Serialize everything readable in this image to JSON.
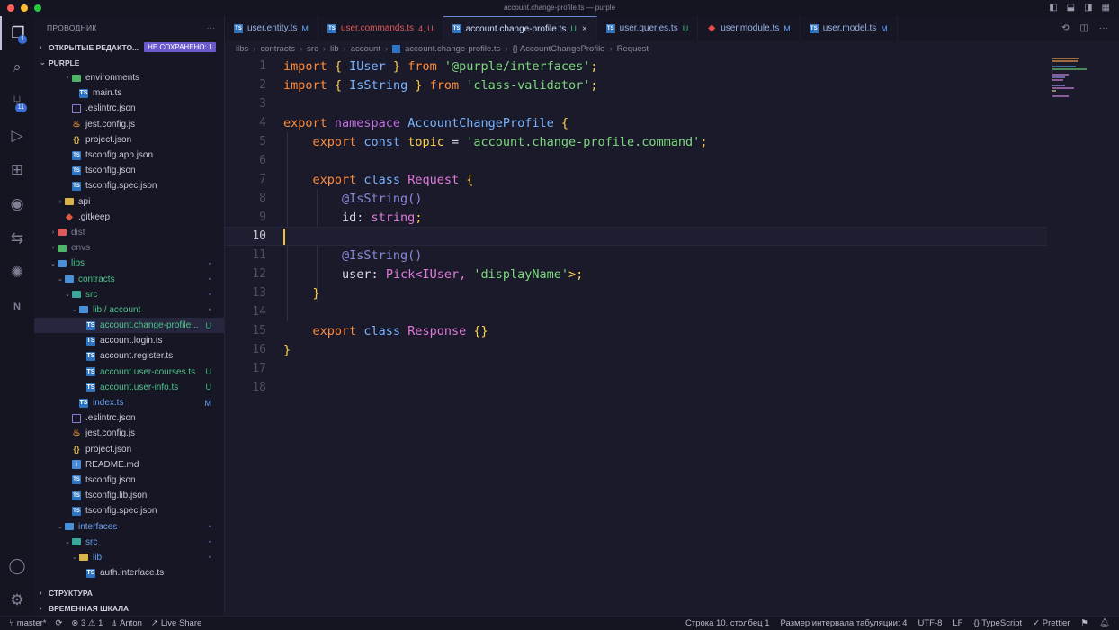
{
  "window": {
    "title": "account.change-profile.ts — purple"
  },
  "activity": {
    "explorer_badge": "1",
    "git_badge": "11"
  },
  "sidebar": {
    "header": "ПРОВОДНИК",
    "open_editors": "ОТКРЫТЫЕ РЕДАКТО...",
    "unsaved_badge": "НЕ СОХРАНЕНО: 1",
    "root": "PURPLE",
    "rows": [
      {
        "label": "environments",
        "indent": 3,
        "chev": "›",
        "icon": "folder green",
        "color": "",
        "stat": ""
      },
      {
        "label": "main.ts",
        "indent": 4,
        "chev": "",
        "icon": "ts",
        "color": "",
        "stat": ""
      },
      {
        "label": ".eslintrc.json",
        "indent": 3,
        "chev": "",
        "icon": "es",
        "color": "",
        "stat": ""
      },
      {
        "label": "jest.config.js",
        "indent": 3,
        "chev": "",
        "icon": "js",
        "color": "",
        "stat": ""
      },
      {
        "label": "project.json",
        "indent": 3,
        "chev": "",
        "icon": "json",
        "color": "",
        "stat": ""
      },
      {
        "label": "tsconfig.app.json",
        "indent": 3,
        "chev": "",
        "icon": "tsconf",
        "color": "",
        "stat": ""
      },
      {
        "label": "tsconfig.json",
        "indent": 3,
        "chev": "",
        "icon": "tsconf",
        "color": "",
        "stat": ""
      },
      {
        "label": "tsconfig.spec.json",
        "indent": 3,
        "chev": "",
        "icon": "tsconf",
        "color": "",
        "stat": ""
      },
      {
        "label": "api",
        "indent": 2,
        "chev": "›",
        "icon": "folder yellow",
        "color": "",
        "stat": ""
      },
      {
        "label": ".gitkeep",
        "indent": 2,
        "chev": "",
        "icon": "git",
        "color": "",
        "stat": ""
      },
      {
        "label": "dist",
        "indent": 1,
        "chev": "›",
        "icon": "folder red",
        "color": "gray",
        "stat": ""
      },
      {
        "label": "envs",
        "indent": 1,
        "chev": "›",
        "icon": "folder green",
        "color": "gray",
        "stat": ""
      },
      {
        "label": "libs",
        "indent": 1,
        "chev": "⌄",
        "icon": "folder",
        "color": "green",
        "stat": "•"
      },
      {
        "label": "contracts",
        "indent": 2,
        "chev": "⌄",
        "icon": "folder",
        "color": "green",
        "stat": "•"
      },
      {
        "label": "src",
        "indent": 3,
        "chev": "⌄",
        "icon": "folder teal",
        "color": "green",
        "stat": "•"
      },
      {
        "label": "lib / account",
        "indent": 4,
        "chev": "⌄",
        "icon": "folder",
        "color": "green",
        "stat": "•"
      },
      {
        "label": "account.change-profile...",
        "indent": 5,
        "chev": "",
        "icon": "ts",
        "color": "green",
        "stat": "U",
        "selected": true
      },
      {
        "label": "account.login.ts",
        "indent": 5,
        "chev": "",
        "icon": "ts",
        "color": "",
        "stat": ""
      },
      {
        "label": "account.register.ts",
        "indent": 5,
        "chev": "",
        "icon": "ts",
        "color": "",
        "stat": ""
      },
      {
        "label": "account.user-courses.ts",
        "indent": 5,
        "chev": "",
        "icon": "ts",
        "color": "green",
        "stat": "U"
      },
      {
        "label": "account.user-info.ts",
        "indent": 5,
        "chev": "",
        "icon": "ts",
        "color": "green",
        "stat": "U"
      },
      {
        "label": "index.ts",
        "indent": 4,
        "chev": "",
        "icon": "ts",
        "color": "blue",
        "stat": "M"
      },
      {
        "label": ".eslintrc.json",
        "indent": 3,
        "chev": "",
        "icon": "es",
        "color": "",
        "stat": ""
      },
      {
        "label": "jest.config.js",
        "indent": 3,
        "chev": "",
        "icon": "js",
        "color": "",
        "stat": ""
      },
      {
        "label": "project.json",
        "indent": 3,
        "chev": "",
        "icon": "json",
        "color": "",
        "stat": ""
      },
      {
        "label": "README.md",
        "indent": 3,
        "chev": "",
        "icon": "info",
        "color": "",
        "stat": ""
      },
      {
        "label": "tsconfig.json",
        "indent": 3,
        "chev": "",
        "icon": "tsconf",
        "color": "",
        "stat": ""
      },
      {
        "label": "tsconfig.lib.json",
        "indent": 3,
        "chev": "",
        "icon": "tsconf",
        "color": "",
        "stat": ""
      },
      {
        "label": "tsconfig.spec.json",
        "indent": 3,
        "chev": "",
        "icon": "tsconf",
        "color": "",
        "stat": ""
      },
      {
        "label": "interfaces",
        "indent": 2,
        "chev": "⌄",
        "icon": "folder",
        "color": "blue",
        "stat": "•"
      },
      {
        "label": "src",
        "indent": 3,
        "chev": "⌄",
        "icon": "folder teal",
        "color": "blue",
        "stat": "•"
      },
      {
        "label": "lib",
        "indent": 4,
        "chev": "⌄",
        "icon": "folder yellow",
        "color": "blue",
        "stat": "•"
      },
      {
        "label": "auth.interface.ts",
        "indent": 5,
        "chev": "",
        "icon": "ts",
        "color": "",
        "stat": ""
      }
    ],
    "bottom": [
      "СТРУКТУРА",
      "ВРЕМЕННАЯ ШКАЛА"
    ]
  },
  "tabs": [
    {
      "name": "user.entity.ts",
      "stat": "M",
      "kind": "ts",
      "err": false,
      "active": false
    },
    {
      "name": "user.commands.ts",
      "stat": "4, U",
      "kind": "ts",
      "err": true,
      "active": false
    },
    {
      "name": "account.change-profile.ts",
      "stat": "U",
      "kind": "ts",
      "err": false,
      "active": true
    },
    {
      "name": "user.queries.ts",
      "stat": "U",
      "kind": "ts",
      "err": false,
      "active": false
    },
    {
      "name": "user.module.ts",
      "stat": "M",
      "kind": "ang",
      "err": false,
      "active": false
    },
    {
      "name": "user.model.ts",
      "stat": "M",
      "kind": "ts",
      "err": false,
      "active": false
    }
  ],
  "breadcrumb": [
    "libs",
    "contracts",
    "src",
    "lib",
    "account",
    "account.change-profile.ts",
    "{} AccountChangeProfile",
    "Request"
  ],
  "editor": {
    "current_line": 10,
    "lines": [
      [
        [
          "import ",
          "k"
        ],
        [
          "{ ",
          "p"
        ],
        [
          "IUser",
          "n"
        ],
        [
          " } ",
          "p"
        ],
        [
          "from ",
          "k"
        ],
        [
          "'@purple/interfaces'",
          "s"
        ],
        [
          ";",
          "p"
        ]
      ],
      [
        [
          "import ",
          "k"
        ],
        [
          "{ ",
          "p"
        ],
        [
          "IsString",
          "n"
        ],
        [
          " } ",
          "p"
        ],
        [
          "from ",
          "k"
        ],
        [
          "'class-validator'",
          "s"
        ],
        [
          ";",
          "p"
        ]
      ],
      [],
      [
        [
          "export ",
          "k"
        ],
        [
          "namespace ",
          "dm"
        ],
        [
          "AccountChangeProfile",
          "n"
        ],
        [
          " {",
          "p"
        ]
      ],
      [
        [
          "    export ",
          "k"
        ],
        [
          "const ",
          "n"
        ],
        [
          "topic",
          "p"
        ],
        [
          " = ",
          "pl"
        ],
        [
          "'account.change-profile.command'",
          "s"
        ],
        [
          ";",
          "p"
        ]
      ],
      [],
      [
        [
          "    export ",
          "k"
        ],
        [
          "class ",
          "n"
        ],
        [
          "Request",
          "t"
        ],
        [
          " {",
          "p"
        ]
      ],
      [
        [
          "        @IsString()",
          "d"
        ]
      ],
      [
        [
          "        id",
          "pl"
        ],
        [
          ": ",
          "pl"
        ],
        [
          "string",
          "t"
        ],
        [
          ";",
          "p"
        ]
      ],
      [],
      [
        [
          "        @IsString()",
          "d"
        ]
      ],
      [
        [
          "        user",
          "pl"
        ],
        [
          ": ",
          "pl"
        ],
        [
          "Pick<IUser, ",
          "t"
        ],
        [
          "'displayName'",
          "s"
        ],
        [
          ">;",
          "p"
        ]
      ],
      [
        [
          "    }",
          "p"
        ]
      ],
      [],
      [
        [
          "    export ",
          "k"
        ],
        [
          "class ",
          "n"
        ],
        [
          "Response",
          "t"
        ],
        [
          " {}",
          "p"
        ]
      ],
      [
        [
          "}",
          "p"
        ]
      ],
      [],
      []
    ]
  },
  "status": {
    "branch": "master*",
    "sync": "⟳",
    "problems": "⊗ 3 ⚠ 1",
    "user": "Anton",
    "liveshare": "Live Share",
    "position": "Строка 10, столбец 1",
    "indent": "Размер интервала табуляции: 4",
    "encoding": "UTF-8",
    "eol": "LF",
    "language": "{} TypeScript",
    "prettier": "✓ Prettier"
  }
}
